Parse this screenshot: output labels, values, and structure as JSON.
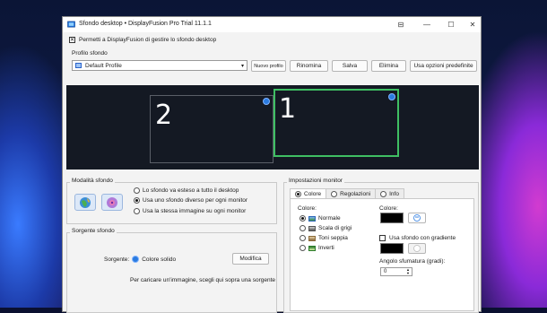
{
  "window": {
    "title": "Sfondo desktop • DisplayFusion Pro Trial 11.1.1",
    "pin_glyph": "⊟",
    "min_glyph": "—",
    "max_glyph": "☐",
    "close_glyph": "✕"
  },
  "permission": {
    "checked": true,
    "check_glyph": "✕",
    "label": "Permetti a DisplayFusion di gestire lo sfondo desktop"
  },
  "profile": {
    "section_label": "Profilo sfondo",
    "selected": "Default Profile",
    "caret": "▾",
    "buttons": {
      "new": "Nuovo profilo",
      "rename": "Rinomina",
      "save": "Salva",
      "delete": "Elimina",
      "defaults": "Usa opzioni predefinite"
    }
  },
  "monitors": [
    {
      "number": "2",
      "selected": false
    },
    {
      "number": "1",
      "selected": true
    }
  ],
  "mode": {
    "title": "Modalità sfondo",
    "options": [
      {
        "label": "Lo sfondo va esteso a tutto il desktop",
        "selected": false
      },
      {
        "label": "Usa uno sfondo diverso per ogni monitor",
        "selected": true
      },
      {
        "label": "Usa la stessa immagine su ogni monitor",
        "selected": false
      }
    ]
  },
  "source": {
    "title": "Sorgente sfondo",
    "label": "Sorgente:",
    "value": "Colore solido",
    "modify_button": "Modifica",
    "hint": "Per caricare un'immagine, scegli qui sopra una sorgente"
  },
  "settings": {
    "title": "Impostazioni monitor",
    "tabs": [
      {
        "label": "Colore",
        "active": true
      },
      {
        "label": "Regolazioni",
        "active": false
      },
      {
        "label": "Info",
        "active": false
      }
    ],
    "color_mode_label": "Colore:",
    "color_modes": [
      {
        "label": "Normale",
        "selected": true
      },
      {
        "label": "Scala di grigi",
        "selected": false
      },
      {
        "label": "Toni seppia",
        "selected": false
      },
      {
        "label": "Inverti",
        "selected": false
      }
    ],
    "color_label": "Colore:",
    "primary_color": "#000000",
    "gradient_label": "Usa sfondo con gradiente",
    "gradient_enabled": false,
    "secondary_color": "#000000",
    "gradient_angle_label": "Angolo sfumatura (gradi):",
    "gradient_angle_value": "0"
  },
  "colors": {
    "monitor_selected_border": "#3fbf63",
    "preview_bg": "#141923"
  }
}
